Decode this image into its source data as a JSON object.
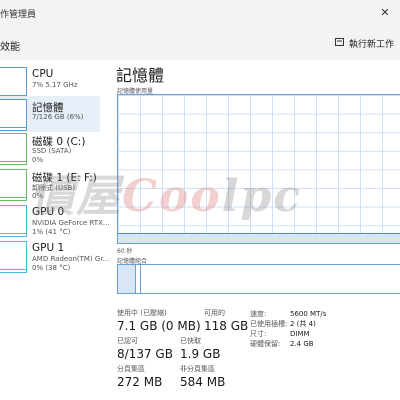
{
  "window": {
    "title": "作管理員",
    "close_glyph": "✕"
  },
  "toolbar": {
    "section_label": "效能",
    "run_task_label": "執行新工作",
    "run_task_icon": "new-task-icon"
  },
  "sidebar": {
    "items": [
      {
        "name": "CPU",
        "sub1": "7% 5.17 GHz",
        "sub2": ""
      },
      {
        "name": "記憶體",
        "sub1": "7/126 GB (6%)",
        "sub2": ""
      },
      {
        "name": "磁碟 0 (C:)",
        "sub1": "SSD (SATA)",
        "sub2": "0%"
      },
      {
        "name": "磁碟 1 (E: F:)",
        "sub1": "卸除式 (USB)",
        "sub2": "0%"
      },
      {
        "name": "GPU 0",
        "sub1": "NVIDIA GeForce RTX...",
        "sub2": "1% (41 °C)"
      },
      {
        "name": "GPU 1",
        "sub1": "AMD Radeon(TM) Gr...",
        "sub2": "0% (38 °C)"
      }
    ]
  },
  "main": {
    "title": "記憶體",
    "graph_label": "記憶體使用量",
    "axis_left": "60 秒",
    "composition_label": "記憶體組合",
    "usage_fraction": 0.06,
    "stats": {
      "in_use_label": "使用中 (已壓縮)",
      "in_use_value": "7.1 GB (0 MB)",
      "available_label": "可用的",
      "available_value": "118 GB",
      "committed_label": "已認可",
      "committed_value": "8/137 GB",
      "cached_label": "已快取",
      "cached_value": "1.9 GB",
      "paged_label": "分頁集區",
      "paged_value": "272 MB",
      "nonpaged_label": "非分頁集區",
      "nonpaged_value": "584 MB"
    },
    "details": [
      {
        "key": "速度:",
        "value": "5600 MT/s"
      },
      {
        "key": "已使用插槽:",
        "value": "2 (共 4)"
      },
      {
        "key": "尺寸:",
        "value": "DIMM"
      },
      {
        "key": "硬體保留:",
        "value": "2.4 GB"
      }
    ]
  },
  "watermark": {
    "text_a": "價屋",
    "text_b": "C",
    "text_c": "oo",
    "text_d": "lpc"
  },
  "colors": {
    "accent": "#5a9bd4",
    "graph_border": "#6a9fd8",
    "selected_bg": "#e6eef7"
  }
}
